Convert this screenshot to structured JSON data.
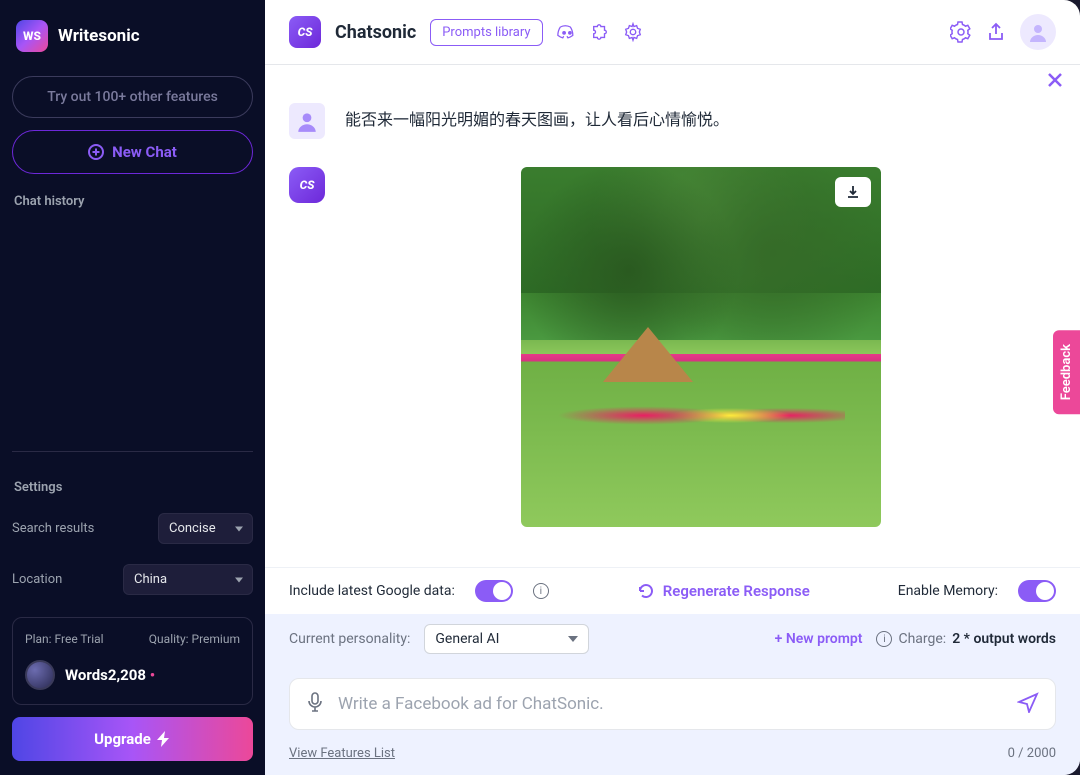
{
  "sidebar": {
    "logo_text": "WS",
    "brand": "Writesonic",
    "other_features": "Try out 100+ other features",
    "new_chat": "New Chat",
    "chat_history_label": "Chat history",
    "settings_label": "Settings",
    "search_results_label": "Search results",
    "search_results_value": "Concise",
    "location_label": "Location",
    "location_value": "China",
    "plan_label": "Plan: Free Trial",
    "quality_label": "Quality: Premium",
    "words_label": "Words",
    "words_count": "2,208",
    "upgrade": "Upgrade"
  },
  "topbar": {
    "cs": "CS",
    "title": "Chatsonic",
    "prompts_library": "Prompts library"
  },
  "chat": {
    "user_message": "能否来一幅阳光明媚的春天图画，让人看后心情愉悦。",
    "bot_badge": "CS"
  },
  "controls": {
    "google_data": "Include latest Google data:",
    "regenerate": "Regenerate Response",
    "enable_memory": "Enable Memory:"
  },
  "personality": {
    "label": "Current personality:",
    "value": "General AI",
    "new_prompt": "+ New prompt",
    "charge_label": "Charge:",
    "charge_value": "2 * output words"
  },
  "input": {
    "placeholder": "Write a Facebook ad for ChatSonic."
  },
  "bottom": {
    "features_link": "View Features List",
    "counter": "0 / 2000"
  },
  "feedback": "Feedback"
}
